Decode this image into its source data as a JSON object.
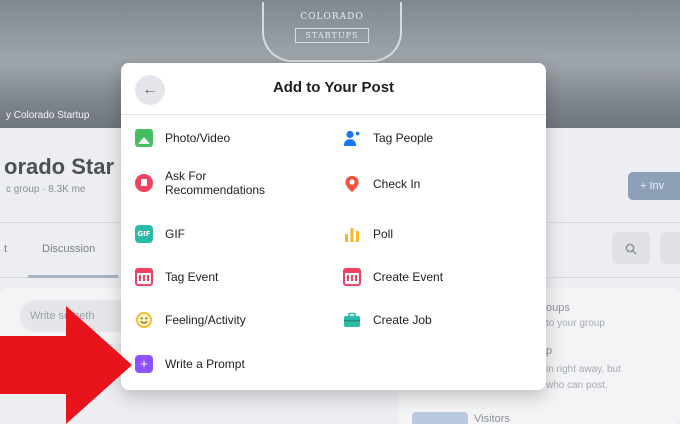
{
  "cover": {
    "crest_line1": "COLORADO",
    "crest_line2": "STARTUPS",
    "caption": "y Colorado Startup"
  },
  "group": {
    "title": "orado Star",
    "meta": "c group · 8.3K me",
    "invite_label": "+ Inv"
  },
  "tabs": [
    {
      "label": "t"
    },
    {
      "label": "Discussion"
    }
  ],
  "composer": {
    "placeholder": "Write someth"
  },
  "side_card": {
    "line1": "oups",
    "line2": "to your group",
    "line3": "p",
    "line4": "in right away, but",
    "line5": "who can post.",
    "line6": "Visitors"
  },
  "modal": {
    "title": "Add to Your Post",
    "options": {
      "photo_video": "Photo/Video",
      "tag_people": "Tag People",
      "ask_recommendations_line1": "Ask For",
      "ask_recommendations_line2": "Recommendations",
      "check_in": "Check In",
      "gif": "GIF",
      "gif_icon_text": "GIF",
      "poll": "Poll",
      "tag_event": "Tag Event",
      "create_event": "Create Event",
      "feeling_activity": "Feeling/Activity",
      "create_job": "Create Job",
      "write_prompt": "Write a Prompt"
    }
  },
  "icons": {
    "back": "arrow-left-icon",
    "photo_video": "photo-icon",
    "tag_people": "person-tag-icon",
    "ask_recommendations": "chat-bubble-icon",
    "check_in": "location-pin-icon",
    "gif": "gif-icon",
    "poll": "bar-chart-icon",
    "tag_event": "calendar-icon",
    "create_event": "calendar-icon",
    "feeling_activity": "smiley-icon",
    "create_job": "briefcase-icon",
    "write_prompt": "prompt-icon",
    "annotation": "red-arrow"
  },
  "colors": {
    "photo": "#45bd62",
    "tag_people": "#1877f2",
    "recommendations": "#f3425f",
    "check_in": "#f5533d",
    "gif": "#2abba7",
    "poll": "#f7b928",
    "event": "#f3425f",
    "feeling": "#f7b928",
    "job": "#2abba7",
    "prompt": "#8c52ff",
    "arrow": "#e8141b"
  }
}
